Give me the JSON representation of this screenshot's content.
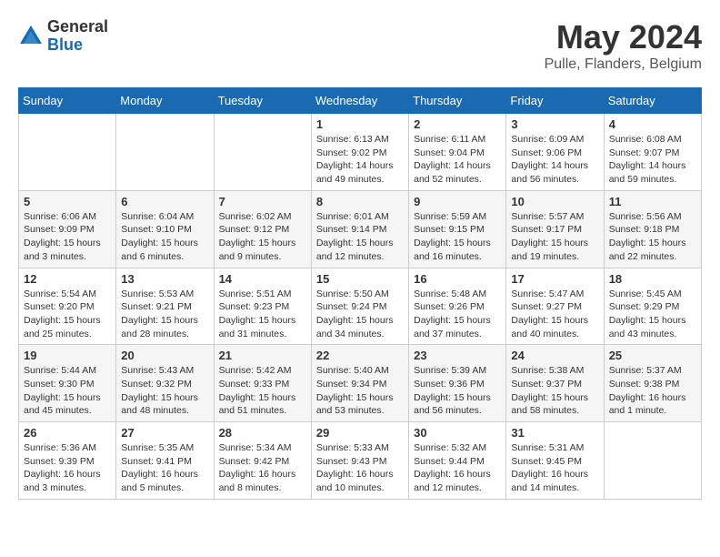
{
  "logo": {
    "general": "General",
    "blue": "Blue"
  },
  "title": "May 2024",
  "location": "Pulle, Flanders, Belgium",
  "days_of_week": [
    "Sunday",
    "Monday",
    "Tuesday",
    "Wednesday",
    "Thursday",
    "Friday",
    "Saturday"
  ],
  "weeks": [
    [
      {
        "num": "",
        "info": ""
      },
      {
        "num": "",
        "info": ""
      },
      {
        "num": "",
        "info": ""
      },
      {
        "num": "1",
        "info": "Sunrise: 6:13 AM\nSunset: 9:02 PM\nDaylight: 14 hours\nand 49 minutes."
      },
      {
        "num": "2",
        "info": "Sunrise: 6:11 AM\nSunset: 9:04 PM\nDaylight: 14 hours\nand 52 minutes."
      },
      {
        "num": "3",
        "info": "Sunrise: 6:09 AM\nSunset: 9:06 PM\nDaylight: 14 hours\nand 56 minutes."
      },
      {
        "num": "4",
        "info": "Sunrise: 6:08 AM\nSunset: 9:07 PM\nDaylight: 14 hours\nand 59 minutes."
      }
    ],
    [
      {
        "num": "5",
        "info": "Sunrise: 6:06 AM\nSunset: 9:09 PM\nDaylight: 15 hours\nand 3 minutes."
      },
      {
        "num": "6",
        "info": "Sunrise: 6:04 AM\nSunset: 9:10 PM\nDaylight: 15 hours\nand 6 minutes."
      },
      {
        "num": "7",
        "info": "Sunrise: 6:02 AM\nSunset: 9:12 PM\nDaylight: 15 hours\nand 9 minutes."
      },
      {
        "num": "8",
        "info": "Sunrise: 6:01 AM\nSunset: 9:14 PM\nDaylight: 15 hours\nand 12 minutes."
      },
      {
        "num": "9",
        "info": "Sunrise: 5:59 AM\nSunset: 9:15 PM\nDaylight: 15 hours\nand 16 minutes."
      },
      {
        "num": "10",
        "info": "Sunrise: 5:57 AM\nSunset: 9:17 PM\nDaylight: 15 hours\nand 19 minutes."
      },
      {
        "num": "11",
        "info": "Sunrise: 5:56 AM\nSunset: 9:18 PM\nDaylight: 15 hours\nand 22 minutes."
      }
    ],
    [
      {
        "num": "12",
        "info": "Sunrise: 5:54 AM\nSunset: 9:20 PM\nDaylight: 15 hours\nand 25 minutes."
      },
      {
        "num": "13",
        "info": "Sunrise: 5:53 AM\nSunset: 9:21 PM\nDaylight: 15 hours\nand 28 minutes."
      },
      {
        "num": "14",
        "info": "Sunrise: 5:51 AM\nSunset: 9:23 PM\nDaylight: 15 hours\nand 31 minutes."
      },
      {
        "num": "15",
        "info": "Sunrise: 5:50 AM\nSunset: 9:24 PM\nDaylight: 15 hours\nand 34 minutes."
      },
      {
        "num": "16",
        "info": "Sunrise: 5:48 AM\nSunset: 9:26 PM\nDaylight: 15 hours\nand 37 minutes."
      },
      {
        "num": "17",
        "info": "Sunrise: 5:47 AM\nSunset: 9:27 PM\nDaylight: 15 hours\nand 40 minutes."
      },
      {
        "num": "18",
        "info": "Sunrise: 5:45 AM\nSunset: 9:29 PM\nDaylight: 15 hours\nand 43 minutes."
      }
    ],
    [
      {
        "num": "19",
        "info": "Sunrise: 5:44 AM\nSunset: 9:30 PM\nDaylight: 15 hours\nand 45 minutes."
      },
      {
        "num": "20",
        "info": "Sunrise: 5:43 AM\nSunset: 9:32 PM\nDaylight: 15 hours\nand 48 minutes."
      },
      {
        "num": "21",
        "info": "Sunrise: 5:42 AM\nSunset: 9:33 PM\nDaylight: 15 hours\nand 51 minutes."
      },
      {
        "num": "22",
        "info": "Sunrise: 5:40 AM\nSunset: 9:34 PM\nDaylight: 15 hours\nand 53 minutes."
      },
      {
        "num": "23",
        "info": "Sunrise: 5:39 AM\nSunset: 9:36 PM\nDaylight: 15 hours\nand 56 minutes."
      },
      {
        "num": "24",
        "info": "Sunrise: 5:38 AM\nSunset: 9:37 PM\nDaylight: 15 hours\nand 58 minutes."
      },
      {
        "num": "25",
        "info": "Sunrise: 5:37 AM\nSunset: 9:38 PM\nDaylight: 16 hours\nand 1 minute."
      }
    ],
    [
      {
        "num": "26",
        "info": "Sunrise: 5:36 AM\nSunset: 9:39 PM\nDaylight: 16 hours\nand 3 minutes."
      },
      {
        "num": "27",
        "info": "Sunrise: 5:35 AM\nSunset: 9:41 PM\nDaylight: 16 hours\nand 5 minutes."
      },
      {
        "num": "28",
        "info": "Sunrise: 5:34 AM\nSunset: 9:42 PM\nDaylight: 16 hours\nand 8 minutes."
      },
      {
        "num": "29",
        "info": "Sunrise: 5:33 AM\nSunset: 9:43 PM\nDaylight: 16 hours\nand 10 minutes."
      },
      {
        "num": "30",
        "info": "Sunrise: 5:32 AM\nSunset: 9:44 PM\nDaylight: 16 hours\nand 12 minutes."
      },
      {
        "num": "31",
        "info": "Sunrise: 5:31 AM\nSunset: 9:45 PM\nDaylight: 16 hours\nand 14 minutes."
      },
      {
        "num": "",
        "info": ""
      }
    ]
  ]
}
